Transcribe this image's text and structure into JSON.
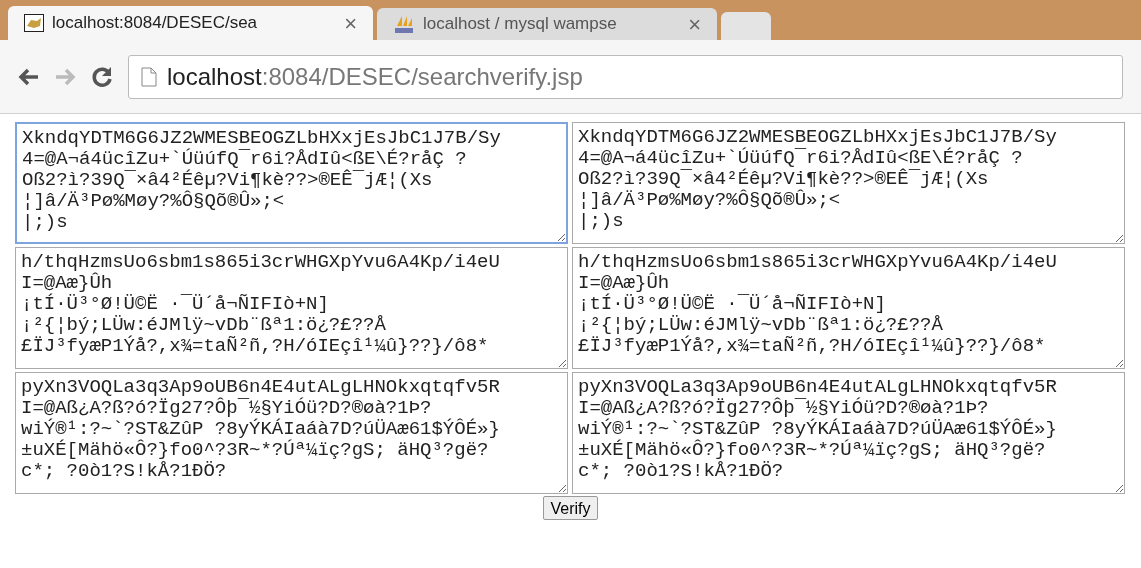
{
  "tabs": [
    {
      "title": "localhost:8084/DESEC/sea",
      "close": "×",
      "selected": true
    },
    {
      "title": "localhost / mysql wampse",
      "close": "×",
      "selected": false
    }
  ],
  "toolbar": {
    "url_host": "localhost",
    "url_path": ":8084/DESEC/searchverify.jsp"
  },
  "text_areas": [
    {
      "value": "XkndqYDTM6G6JZ2WMESBEOGZLbHXxjEsJbC1J7B/Sy\n4=@A¬á4ücîZu+`ÚüúfQ¯r6i?ÅdIû<ßE\\É?råÇ ?\nOß2?ì?39Q¯×â4²Éêµ?Vi¶kè??>®EÊ¯jÆ¦(Xs\n¦]â/Ä³Pø%Møy?%Ô§Qõ®Û»;<\n|;)s",
      "focused": true
    },
    {
      "value": "XkndqYDTM6G6JZ2WMESBEOGZLbHXxjEsJbC1J7B/Sy\n4=@A¬á4ücîZu+`ÚüúfQ¯r6i?ÅdIû<ßE\\É?råÇ ?\nOß2?ì?39Q¯×â4²Éêµ?Vi¶kè??>®EÊ¯jÆ¦(Xs\n¦]â/Ä³Pø%Møy?%Ô§Qõ®Û»;<\n|;)s",
      "focused": false
    },
    {
      "value": "h/thqHzmsUo6sbm1s865i3crWHGXpYvu6A4Kp/i4eU\nI=@Aæ}Ûh\n¡tÍ·Ü³°Ø!Ü©Ë ·¯Ü´å¬ÑIFIò+N]\n¡²{¦bý;LÜw:éJMlÿ~vDb¨ßª1:ö¿?£??Å\n£ÏJ³fyæP1Ýå?,x¾=taÑ²ñ,?H/óIEçî¹¼û}??}/ô8*",
      "focused": false
    },
    {
      "value": "h/thqHzmsUo6sbm1s865i3crWHGXpYvu6A4Kp/i4eU\nI=@Aæ}Ûh\n¡tÍ·Ü³°Ø!Ü©Ë ·¯Ü´å¬ÑIFIò+N]\n¡²{¦bý;LÜw:éJMlÿ~vDb¨ßª1:ö¿?£??Å\n£ÏJ³fyæP1Ýå?,x¾=taÑ²ñ,?H/óIEçî¹¼û}??}/ô8*",
      "focused": false
    },
    {
      "value": "pyXn3VOQLa3q3Ap9oUB6n4E4utALgLHNOkxqtqfv5R\nI=@Aß¿A?ß?ó?Ïg27?Ôþ¯½§YiÓü?D?®øà?1Þ?\nwiÝ®¹:?~`?ST&ZûP ?8yÝKÁIaáà7D?úÜAæ61$ÝÔÉ»}\n±uXÉ[Mähö«Ô?}fo0^?3R~*?Úª¼ïç?gS; äHQ³?gë?\nc*; ?0ò1?S!kÅ?1ÐÖ?",
      "focused": false
    },
    {
      "value": "pyXn3VOQLa3q3Ap9oUB6n4E4utALgLHNOkxqtqfv5R\nI=@Aß¿A?ß?ó?Ïg27?Ôþ¯½§YiÓü?D?®øà?1Þ?\nwiÝ®¹:?~`?ST&ZûP ?8yÝKÁIaáà7D?úÜAæ61$ÝÔÉ»}\n±uXÉ[Mähö«Ô?}fo0^?3R~*?Úª¼ïç?gS; äHQ³?gë?\nc*; ?0ò1?S!kÅ?1ÐÖ?",
      "focused": false
    }
  ],
  "verify_button": "Verify"
}
